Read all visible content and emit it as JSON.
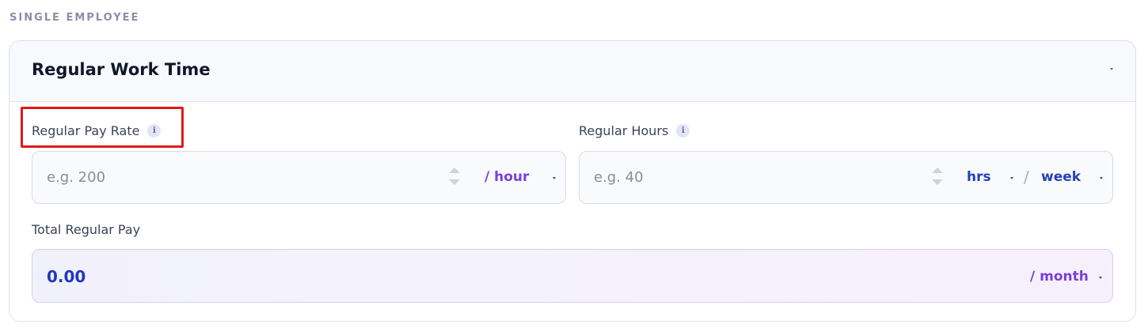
{
  "section": {
    "label": "SINGLE EMPLOYEE"
  },
  "card": {
    "title": "Regular Work Time",
    "collapse_icon": "caret-down-icon"
  },
  "pay_rate": {
    "label": "Regular Pay Rate",
    "info_icon_glyph": "i",
    "placeholder": "e.g. 200",
    "unit": "/ hour"
  },
  "hours": {
    "label": "Regular Hours",
    "info_icon_glyph": "i",
    "placeholder": "e.g. 40",
    "unit_hours": "hrs",
    "unit_separator": "/",
    "unit_period": "week"
  },
  "total": {
    "label": "Total Regular Pay",
    "value": "0.00",
    "unit": "/ month"
  },
  "colors": {
    "highlight": "#e11919",
    "unit_purple": "#7c3ed8",
    "unit_blue": "#2540b8",
    "total_value": "#2236c0"
  }
}
